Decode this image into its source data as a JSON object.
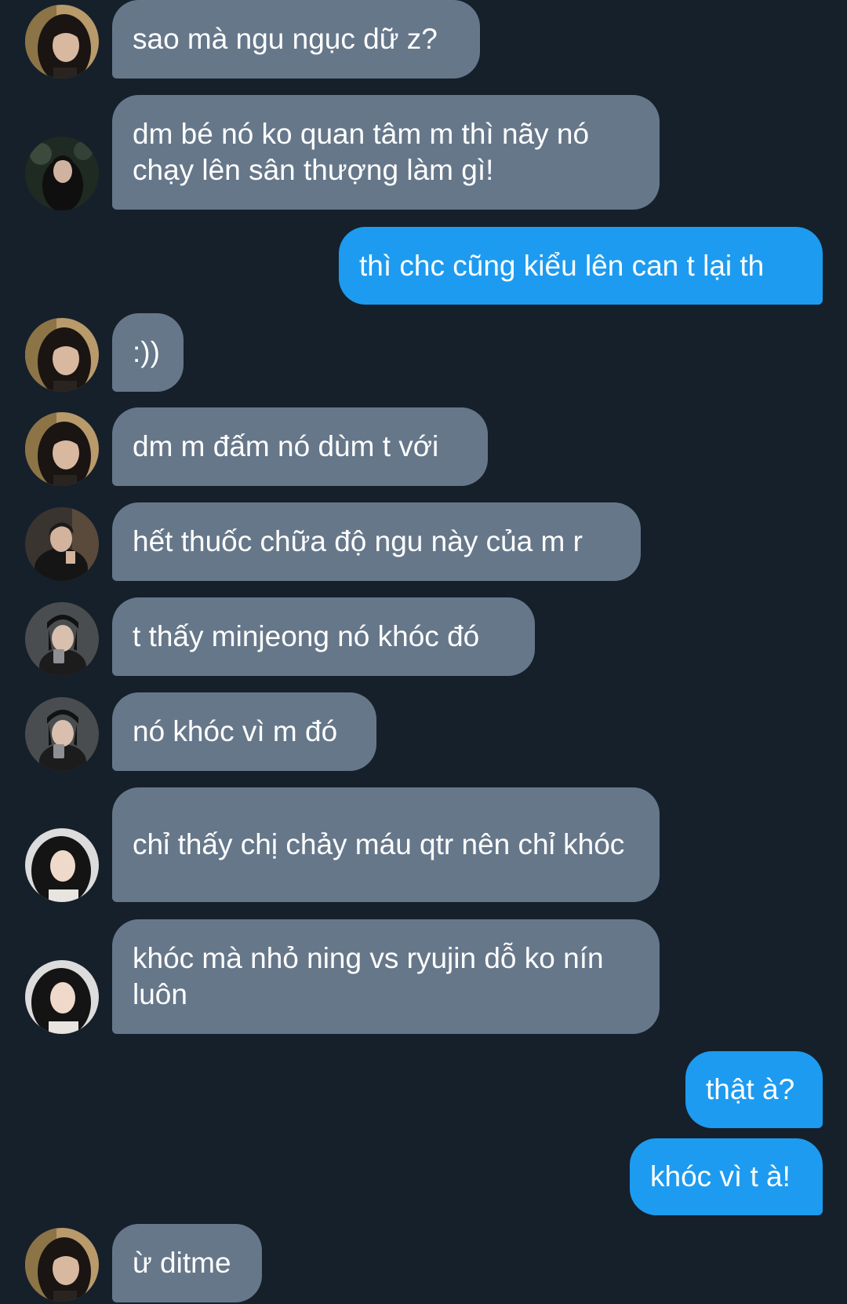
{
  "app": {
    "background": "#16202b",
    "incoming_bubble_color": "#66778a",
    "outgoing_bubble_color": "#1d9bf0"
  },
  "messages": [
    {
      "id": 1,
      "direction": "incoming",
      "avatar": "avatar-a",
      "text": "sao mà ngu ngục dữ z?"
    },
    {
      "id": 2,
      "direction": "incoming",
      "avatar": "avatar-b",
      "text": "dm bé nó ko quan tâm m thì nãy nó chạy lên sân thượng làm gì!"
    },
    {
      "id": 3,
      "direction": "outgoing",
      "text": "thì chc cũng kiểu lên can t lại th"
    },
    {
      "id": 4,
      "direction": "incoming",
      "avatar": "avatar-a",
      "text": ":))"
    },
    {
      "id": 5,
      "direction": "incoming",
      "avatar": "avatar-a",
      "text": "dm m đấm nó dùm t với"
    },
    {
      "id": 6,
      "direction": "incoming",
      "avatar": "avatar-c",
      "text": "hết thuốc chữa độ ngu này của m r"
    },
    {
      "id": 7,
      "direction": "incoming",
      "avatar": "avatar-d",
      "text": "t thấy minjeong nó khóc đó"
    },
    {
      "id": 8,
      "direction": "incoming",
      "avatar": "avatar-d",
      "text": "nó khóc vì m đó"
    },
    {
      "id": 9,
      "direction": "incoming",
      "avatar": "avatar-e",
      "text": "chỉ thấy chị chảy máu qtr nên chỉ khóc"
    },
    {
      "id": 10,
      "direction": "incoming",
      "avatar": "avatar-e",
      "text": "khóc mà nhỏ ning vs ryujin dỗ ko nín luôn"
    },
    {
      "id": 11,
      "direction": "outgoing",
      "text": "thật à?"
    },
    {
      "id": 12,
      "direction": "outgoing",
      "text": "khóc vì t à!"
    },
    {
      "id": 13,
      "direction": "incoming",
      "avatar": "avatar-a",
      "text": "ừ ditme"
    }
  ]
}
